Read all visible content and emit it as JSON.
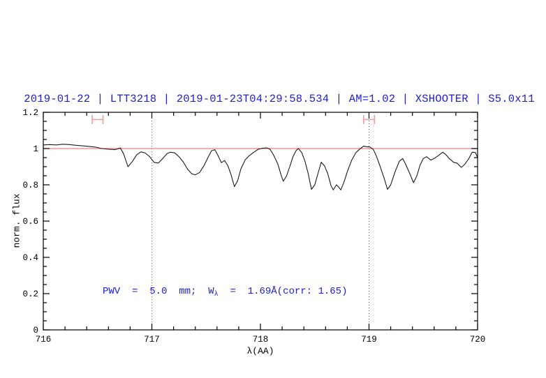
{
  "title": {
    "text": "2019-01-22 | LTT3218 | 2019-01-23T04:29:58.534 | AM=1.02 | XSHOOTER | S5.0x11",
    "color": "#2020cc"
  },
  "annotation": {
    "full": "PWV  =  5.0  mm;  Wλ  =  1.69Å(corr: 1.65)",
    "prefix": "PWV  =  5.0  mm;  W",
    "subscript": "λ",
    "suffix": "  =  1.69Å(corr: 1.65)",
    "color": "#2020cc"
  },
  "axes": {
    "x": {
      "label": "λ(AA)",
      "tick_labels": [
        "716",
        "717",
        "718",
        "719",
        "720"
      ]
    },
    "y": {
      "label": "norm. flux",
      "tick_labels": [
        "0",
        "0.2",
        "0.4",
        "0.6",
        "0.8",
        "1",
        "1.2"
      ]
    }
  },
  "chart_data": {
    "type": "line",
    "title": "2019-01-22 | LTT3218 | 2019-01-23T04:29:58.534 | AM=1.02 | XSHOOTER | S5.0x11",
    "xlabel": "λ(AA)",
    "ylabel": "norm. flux",
    "xlim": [
      716,
      720
    ],
    "ylim": [
      0,
      1.2
    ],
    "x_major_ticks": [
      716,
      717,
      718,
      719,
      720
    ],
    "x_minor_step": 0.2,
    "y_major_ticks": [
      0,
      0.2,
      0.4,
      0.6,
      0.8,
      1.0,
      1.2
    ],
    "y_minor_step": 0.05,
    "grid": "dotted vertical lines at x=717 and x=719 only",
    "gridlines_x": [
      717,
      719
    ],
    "legend": "none",
    "continuum_level": 1.0,
    "band_markers": [
      {
        "x": 716.5,
        "y": 1.16,
        "half_width_x": 0.05,
        "cap_half_height_y": 0.025
      },
      {
        "x": 719.0,
        "y": 1.16,
        "half_width_x": 0.05,
        "cap_half_height_y": 0.025
      }
    ],
    "colors": {
      "spectrum": "#1a1a1a",
      "continuum": "#f08080",
      "marker": "#f49c9c",
      "frame": "#000000",
      "gridline": "#555555"
    },
    "series": [
      {
        "name": "observed spectrum",
        "color": "#1a1a1a",
        "points": [
          [
            716.0,
            1.02
          ],
          [
            716.06,
            1.022
          ],
          [
            716.12,
            1.02
          ],
          [
            716.18,
            1.024
          ],
          [
            716.24,
            1.022
          ],
          [
            716.3,
            1.018
          ],
          [
            716.36,
            1.015
          ],
          [
            716.42,
            1.012
          ],
          [
            716.48,
            1.008
          ],
          [
            716.54,
            1.0
          ],
          [
            716.6,
            0.996
          ],
          [
            716.66,
            0.994
          ],
          [
            716.71,
            1.003
          ],
          [
            716.74,
            0.97
          ],
          [
            716.78,
            0.9
          ],
          [
            716.82,
            0.928
          ],
          [
            716.86,
            0.965
          ],
          [
            716.9,
            0.982
          ],
          [
            716.94,
            0.975
          ],
          [
            716.98,
            0.955
          ],
          [
            717.02,
            0.924
          ],
          [
            717.06,
            0.92
          ],
          [
            717.1,
            0.945
          ],
          [
            717.14,
            0.972
          ],
          [
            717.17,
            0.98
          ],
          [
            717.21,
            0.976
          ],
          [
            717.25,
            0.955
          ],
          [
            717.29,
            0.925
          ],
          [
            717.33,
            0.885
          ],
          [
            717.37,
            0.86
          ],
          [
            717.4,
            0.855
          ],
          [
            717.44,
            0.868
          ],
          [
            717.48,
            0.905
          ],
          [
            717.52,
            0.955
          ],
          [
            717.55,
            0.988
          ],
          [
            717.58,
            0.994
          ],
          [
            717.61,
            0.96
          ],
          [
            717.64,
            0.922
          ],
          [
            717.67,
            0.934
          ],
          [
            717.7,
            0.905
          ],
          [
            717.73,
            0.855
          ],
          [
            717.76,
            0.79
          ],
          [
            717.79,
            0.822
          ],
          [
            717.82,
            0.888
          ],
          [
            717.86,
            0.938
          ],
          [
            717.9,
            0.962
          ],
          [
            717.94,
            0.98
          ],
          [
            717.98,
            0.996
          ],
          [
            718.02,
            1.002
          ],
          [
            718.06,
            1.004
          ],
          [
            718.09,
            0.995
          ],
          [
            718.12,
            0.965
          ],
          [
            718.16,
            0.915
          ],
          [
            718.19,
            0.855
          ],
          [
            718.21,
            0.82
          ],
          [
            718.24,
            0.848
          ],
          [
            718.27,
            0.9
          ],
          [
            718.3,
            0.955
          ],
          [
            718.33,
            0.99
          ],
          [
            718.35,
            1.0
          ],
          [
            718.38,
            0.978
          ],
          [
            718.41,
            0.93
          ],
          [
            718.44,
            0.862
          ],
          [
            718.47,
            0.775
          ],
          [
            718.5,
            0.8
          ],
          [
            718.53,
            0.862
          ],
          [
            718.56,
            0.925
          ],
          [
            718.59,
            0.905
          ],
          [
            718.62,
            0.862
          ],
          [
            718.65,
            0.795
          ],
          [
            718.67,
            0.772
          ],
          [
            718.7,
            0.8
          ],
          [
            718.72,
            0.788
          ],
          [
            718.74,
            0.772
          ],
          [
            718.77,
            0.815
          ],
          [
            718.8,
            0.872
          ],
          [
            718.84,
            0.935
          ],
          [
            718.88,
            0.978
          ],
          [
            718.92,
            1.0
          ],
          [
            718.95,
            1.013
          ],
          [
            718.98,
            1.01
          ],
          [
            719.01,
            1.008
          ],
          [
            719.04,
            0.995
          ],
          [
            719.07,
            0.955
          ],
          [
            719.1,
            0.905
          ],
          [
            719.14,
            0.835
          ],
          [
            719.17,
            0.775
          ],
          [
            719.2,
            0.8
          ],
          [
            719.24,
            0.872
          ],
          [
            719.28,
            0.93
          ],
          [
            719.31,
            0.945
          ],
          [
            719.34,
            0.91
          ],
          [
            719.38,
            0.855
          ],
          [
            719.41,
            0.812
          ],
          [
            719.44,
            0.848
          ],
          [
            719.47,
            0.908
          ],
          [
            719.5,
            0.945
          ],
          [
            719.53,
            0.955
          ],
          [
            719.57,
            0.936
          ],
          [
            719.6,
            0.945
          ],
          [
            719.64,
            0.962
          ],
          [
            719.68,
            0.98
          ],
          [
            719.71,
            0.965
          ],
          [
            719.74,
            0.944
          ],
          [
            719.78,
            0.924
          ],
          [
            719.81,
            0.92
          ],
          [
            719.85,
            0.896
          ],
          [
            719.88,
            0.912
          ],
          [
            719.92,
            0.945
          ],
          [
            719.95,
            0.98
          ],
          [
            719.98,
            0.978
          ],
          [
            720.0,
            0.95
          ]
        ]
      }
    ]
  }
}
